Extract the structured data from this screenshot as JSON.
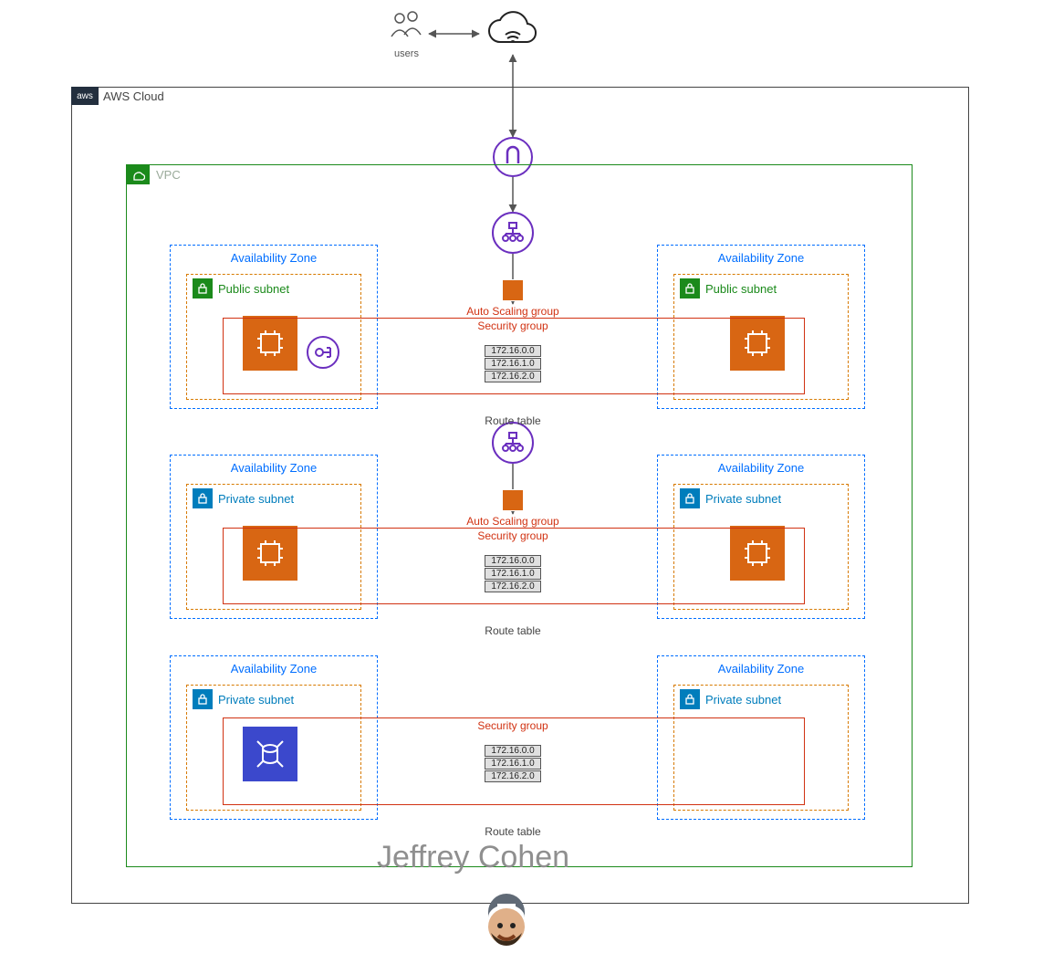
{
  "users_label": "users",
  "aws_label": "AWS Cloud",
  "aws_badge": "aws",
  "vpc_label": "VPC",
  "tiers": [
    {
      "az_label": "Availability Zone",
      "subnet_type": "public",
      "subnet_label": "Public subnet",
      "has_asg": true,
      "asg_label": "Auto Scaling group",
      "sg_label": "Security group",
      "route_rows": [
        "172.16.0.0",
        "172.16.1.0",
        "172.16.2.0"
      ],
      "route_caption": "Route table",
      "left_icon": "ec2",
      "right_icon": "ec2",
      "has_nat": true
    },
    {
      "az_label": "Availability Zone",
      "subnet_type": "private",
      "subnet_label": "Private subnet",
      "has_asg": true,
      "asg_label": "Auto Scaling group",
      "sg_label": "Security group",
      "route_rows": [
        "172.16.0.0",
        "172.16.1.0",
        "172.16.2.0"
      ],
      "route_caption": "Route table",
      "left_icon": "ec2",
      "right_icon": "ec2",
      "has_nat": false
    },
    {
      "az_label": "Availability Zone",
      "subnet_type": "private",
      "subnet_label": "Private subnet",
      "has_asg": false,
      "asg_label": "",
      "sg_label": "Security group",
      "route_rows": [
        "172.16.0.0",
        "172.16.1.0",
        "172.16.2.0"
      ],
      "route_caption": "Route table",
      "left_icon": "rds",
      "right_icon": "",
      "has_nat": false
    }
  ],
  "watermark": "Jeffrey Cohen"
}
